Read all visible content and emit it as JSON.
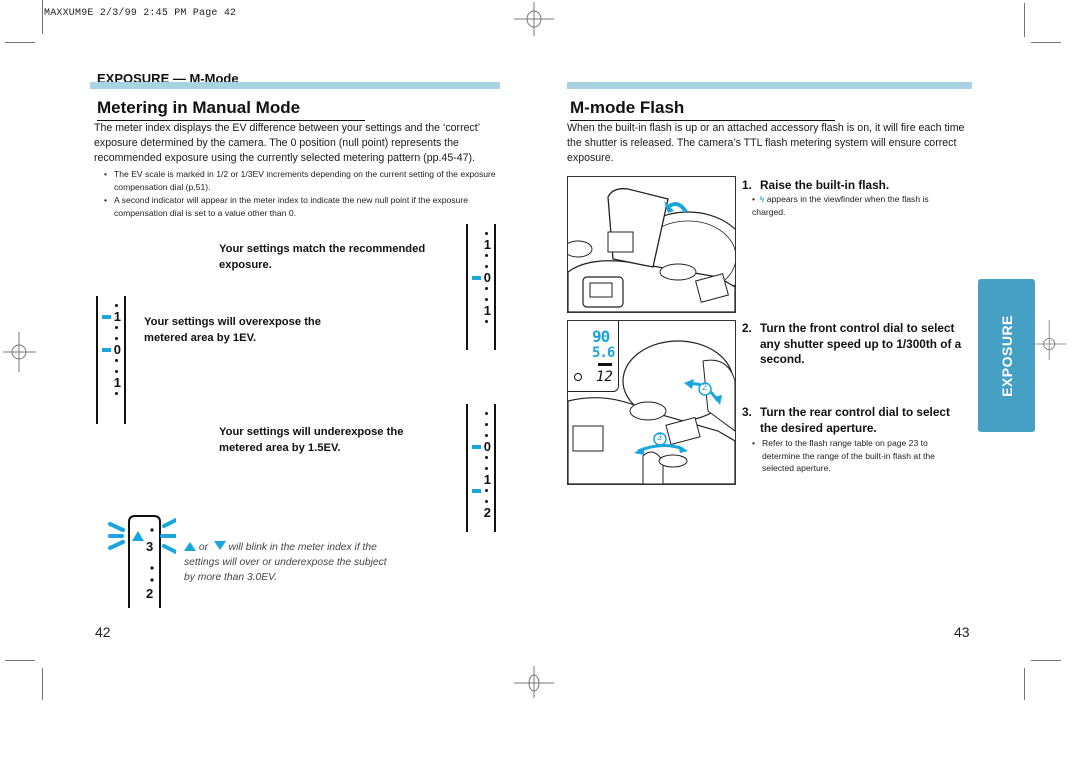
{
  "slug": "MAXXUM9E  2/3/99 2:45 PM  Page 42",
  "left_page": {
    "section_label": "EXPOSURE — M-Mode",
    "title": "Metering in Manual Mode",
    "intro": "The meter index displays the EV difference between your settings and the ‘correct’ exposure determined by the camera. The 0 position (null point) represents the recommended exposure using the currently selected metering pattern (pp.45-47).",
    "bullets": [
      "The EV scale is marked in 1/2 or 1/3EV increments depending on the current setting of the exposure compensation dial (p.51).",
      "A second indicator will appear in the meter index to indicate the new null point if the exposure compensation dial is set to a value other than 0."
    ],
    "cases": [
      {
        "text": "Your settings match the recommended exposure."
      },
      {
        "text": "Your settings will overexpose the metered area by 1EV."
      },
      {
        "text": "Your settings will underexpose the metered area by 1.5EV."
      }
    ],
    "meter_scales": {
      "match": [
        "",
        "1",
        "",
        "",
        "0",
        "",
        "",
        "1",
        ""
      ],
      "over": [
        "",
        "1",
        "",
        "",
        "0",
        "",
        "",
        "1",
        ""
      ],
      "under": [
        "",
        "",
        "",
        "0",
        "",
        "",
        "1",
        "",
        "",
        "2"
      ],
      "blink": [
        "",
        "3",
        "",
        "",
        "2"
      ]
    },
    "note": {
      "or_label": "or",
      "line1_rest": "will blink in the meter index if the",
      "line2": "settings will over or underexpose the subject",
      "line3": "by more than 3.0EV."
    },
    "page_number": "42"
  },
  "right_page": {
    "title": "M-mode Flash",
    "intro": "When the built-in flash is up or an attached accessory flash is on, it will fire each time the shutter is released. The camera’s TTL flash metering system will ensure correct exposure.",
    "steps": [
      {
        "num": "1.",
        "text": "Raise the built-in flash.",
        "bullet": "appears in the viewfinder when the flash is charged."
      },
      {
        "num": "2.",
        "text": "Turn the front control dial to select any shutter speed up to 1/300th of a second."
      },
      {
        "num": "3.",
        "text": "Turn the rear control dial to select the desired aperture.",
        "bullet": "Refer to the flash range table on page 23 to determine the range of the built-in flash at the selected aperture."
      }
    ],
    "illustration_lcd": {
      "shutter": "90",
      "aperture": "5.6",
      "frame": "12"
    },
    "callouts": [
      "2",
      "3"
    ],
    "side_tab": "EXPOSURE",
    "page_number": "43"
  },
  "colors": {
    "accent": "#1aa5dd",
    "bar": "#a9d3e3",
    "tab": "#45a0c4"
  }
}
